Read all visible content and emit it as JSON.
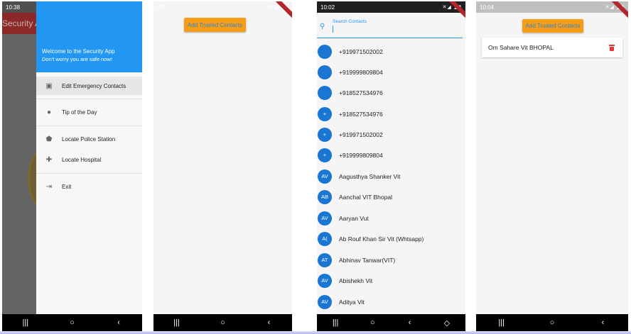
{
  "phone1": {
    "status_time": "10:38",
    "bg_app_title": "Security A",
    "drawer_title": "Welcome to the Security App",
    "drawer_subtitle": "Don't worry you are safe now!",
    "items": [
      {
        "label": "Edit Emergency Contacts",
        "icon": "contacts-icon",
        "selected": true
      },
      {
        "label": "Tip of the Day",
        "icon": "lightbulb-icon",
        "selected": false
      },
      {
        "label": "Locate Police Station",
        "icon": "shield-icon",
        "selected": false
      },
      {
        "label": "Locate Hospital",
        "icon": "hospital-icon",
        "selected": false
      },
      {
        "label": "Exit",
        "icon": "exit-icon",
        "selected": false
      }
    ]
  },
  "phone2": {
    "status_time": ":59",
    "add_button": "Add Trusted Contacts"
  },
  "phone3": {
    "status_time": "10:02",
    "search_label": "Search Contacts",
    "contacts": [
      {
        "initials": "",
        "name": "+919971502002"
      },
      {
        "initials": "",
        "name": "+919999809804"
      },
      {
        "initials": "",
        "name": "+918527534976"
      },
      {
        "initials": "+",
        "name": "+918527534976"
      },
      {
        "initials": "+",
        "name": "+919971502002"
      },
      {
        "initials": "+",
        "name": "+919999809804"
      },
      {
        "initials": "AV",
        "name": "Aagusthya Shanker Vit"
      },
      {
        "initials": "AB",
        "name": "Aanchal VIT Bhopal"
      },
      {
        "initials": "AV",
        "name": "Aaryan Vut"
      },
      {
        "initials": "A(",
        "name": "Ab Rouf Khan Sir Vit (Whtsapp)"
      },
      {
        "initials": "AT",
        "name": "Abhinav Tanwar(VIT)"
      },
      {
        "initials": "AV",
        "name": "Abishekh Vit"
      },
      {
        "initials": "AV",
        "name": "Aditya Vit"
      }
    ]
  },
  "phone4": {
    "status_time": "10:04",
    "add_button": "Add Trusted Contacts",
    "trusted_contact": "Om Sahare Vit BHOPAL"
  },
  "navbar": {
    "recents": "|||",
    "home": "○",
    "back": "‹",
    "rotate": "◇"
  },
  "colors": {
    "primary": "#2196f3",
    "avatar": "#1976d2",
    "button": "#f59d17",
    "delete": "#e53935"
  }
}
